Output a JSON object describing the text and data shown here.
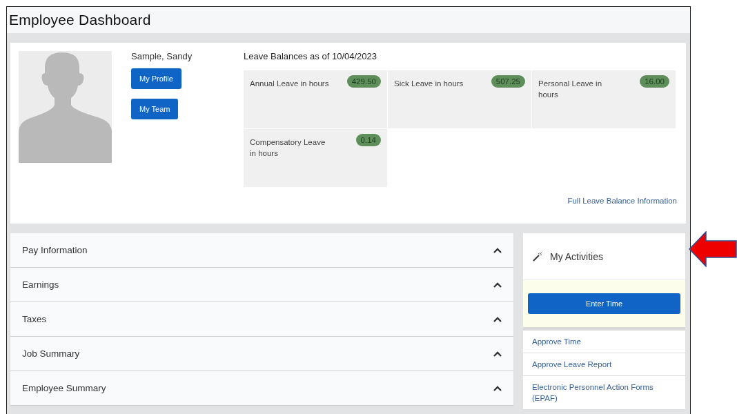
{
  "page": {
    "title": "Employee Dashboard"
  },
  "profile": {
    "name": "Sample, Sandy",
    "buttons": [
      "My Profile",
      "My Team"
    ]
  },
  "leave": {
    "heading": "Leave Balances as of 10/04/2023",
    "balances": [
      {
        "label": "Annual Leave in hours",
        "value": "429.50"
      },
      {
        "label": "Sick Leave in hours",
        "value": "507.25"
      },
      {
        "label": "Personal Leave in hours",
        "value": "16.00"
      },
      {
        "label": "Compensatory Leave in hours",
        "value": "0.14"
      }
    ],
    "link": "Full Leave Balance Information"
  },
  "sections": [
    "Pay Information",
    "Earnings",
    "Taxes",
    "Job Summary",
    "Employee Summary"
  ],
  "activities": {
    "title": "My Activities",
    "button": "Enter Time",
    "links": [
      "Approve Time",
      "Approve Leave Report",
      "Electronic Personnel Action Forms (EPAF)"
    ]
  }
}
